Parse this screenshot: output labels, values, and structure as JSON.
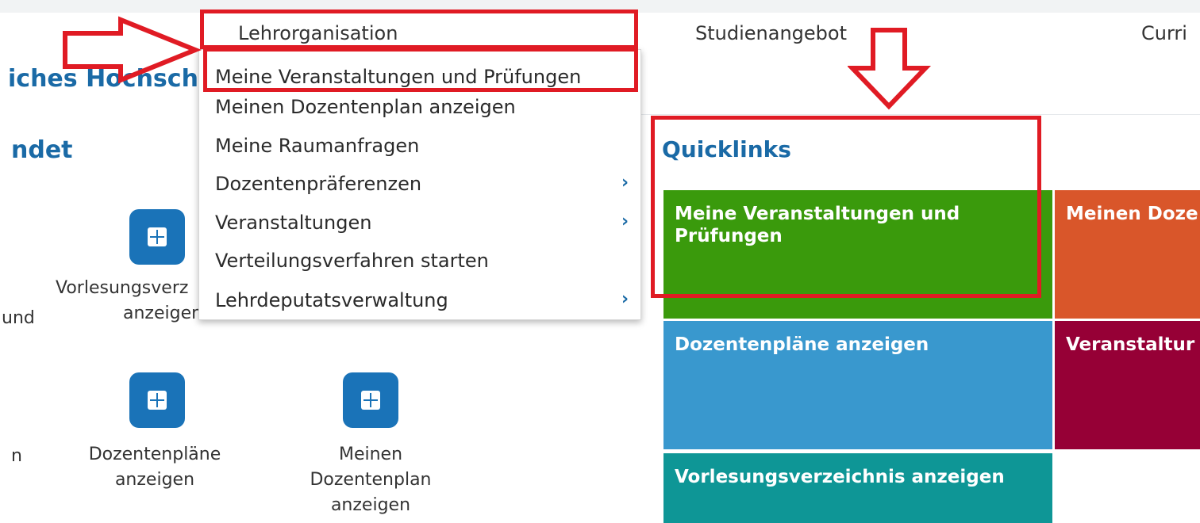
{
  "nav": {
    "lehrorganisation": "Lehrorganisation",
    "studienangebot": "Studienangebot",
    "curri": "Curri"
  },
  "left": {
    "heading_partial": "iches Hochsch",
    "section_partial": "ndet",
    "icons": [
      {
        "label_lines": [
          "Vorlesungsverz",
          "anzeigen"
        ]
      },
      {
        "label_lines": [
          "Dozentenpläne",
          "anzeigen"
        ]
      },
      {
        "label_lines": [
          "Meinen",
          "Dozentenplan",
          "anzeigen"
        ]
      }
    ],
    "partial_und": "und",
    "partial_n": "n"
  },
  "menu": {
    "items": [
      {
        "label": "Meine Veranstaltungen und Prüfungen"
      },
      {
        "label": "Meinen Dozentenplan anzeigen"
      },
      {
        "label": "Meine Raumanfragen"
      },
      {
        "label": "Dozentenpräferenzen",
        "chevron": "›"
      },
      {
        "label": "Veranstaltungen",
        "chevron": "›"
      },
      {
        "label": "Verteilungsverfahren starten"
      },
      {
        "label": "Lehrdeputatsverwaltung",
        "chevron": "›"
      }
    ]
  },
  "quicklinks": {
    "title": "Quicklinks",
    "tiles": [
      {
        "label": "Meine Veranstaltungen und Prüfungen",
        "color": "#3a9a0c"
      },
      {
        "label": "Meinen Doze",
        "color": "#d9562a"
      },
      {
        "label": "Dozentenpläne anzeigen",
        "color": "#3998ce"
      },
      {
        "label": "Veranstaltur",
        "color": "#960036"
      },
      {
        "label": "Vorlesungsverzeichnis anzeigen",
        "color": "#0e9696"
      }
    ]
  },
  "annotations": {
    "color": "#e01b24"
  }
}
